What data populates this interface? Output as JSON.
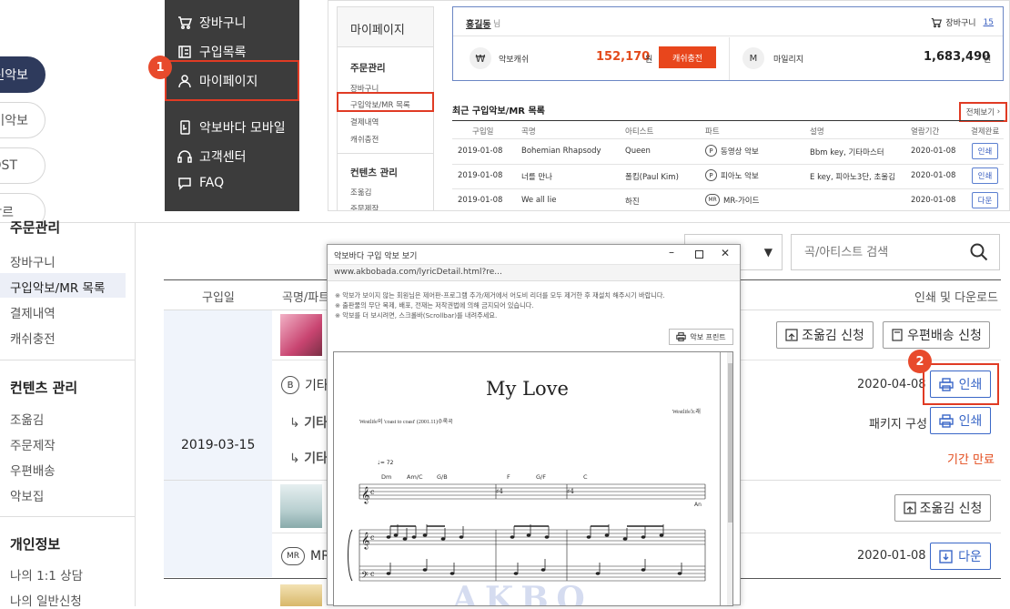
{
  "panel1": {
    "pills": [
      "신악보",
      "기악보",
      "OST",
      "장르"
    ],
    "menu": [
      "장바구니",
      "구입목록",
      "마이페이지",
      "악보바다 모바일",
      "고객센터",
      "FAQ"
    ],
    "badge": "1"
  },
  "panel2": {
    "side_title": "마이페이지",
    "order_head": "주문관리",
    "order_items": [
      "장바구니",
      "구입악보/MR 목록",
      "결제내역",
      "캐쉬충전"
    ],
    "content_head": "컨텐츠 관리",
    "content_items": [
      "조옮김",
      "주문제작"
    ],
    "user_name": "홍길동",
    "user_suffix": "님",
    "cart_label": "장바구니",
    "cart_count": "15",
    "cash_label": "악보캐쉬",
    "cash_value": "152,170",
    "won": "원",
    "charge_btn": "캐쉬충전",
    "mileage_label": "마일리지",
    "mileage_value": "1,683,490",
    "recent_title": "최근 구입악보/MR 목록",
    "view_all": "전체보기",
    "headers": [
      "구입일",
      "곡명",
      "아티스트",
      "파트",
      "설명",
      "열람기간",
      "결제완료"
    ],
    "rows": [
      {
        "date": "2019-01-08",
        "title": "Bohemian Rhapsody",
        "artist": "Queen",
        "part_icon": "P",
        "part": "동영상 악보",
        "desc": "Bbm key, 기타마스터",
        "period": "2020-01-08",
        "btn": "인쇄"
      },
      {
        "date": "2019-01-08",
        "title": "너를 만나",
        "artist": "폴킴(Paul Kim)",
        "part_icon": "P",
        "part": "피아노 악보",
        "desc": "E key, 피아노3단, 초울김",
        "period": "2020-01-08",
        "btn": "인쇄"
      },
      {
        "date": "2019-01-08",
        "title": "We all lie",
        "artist": "하진",
        "part_icon": "MR",
        "part": "MR-가이드",
        "desc": "",
        "period": "2020-01-08",
        "btn": "다운"
      }
    ]
  },
  "panel3": {
    "side_head_order": "주문관리",
    "side_order": [
      "장바구니",
      "구입악보/MR 목록",
      "결제내역",
      "캐쉬충전"
    ],
    "side_head_content": "컨텐츠 관리",
    "side_content": [
      "조옮김",
      "주문제작",
      "우편배송",
      "악보집"
    ],
    "side_head_personal": "개인정보",
    "side_personal": [
      "나의 1:1 상담",
      "나의 일반신청"
    ],
    "search_placeholder": "곡/아티스트 검색",
    "col_date": "구입일",
    "col_title": "곡명/파트",
    "col_actions": "인쇄 및 다운로드",
    "purchase_date": "2019-03-15",
    "transpose_btn": "조옮김 신청",
    "mail_btn": "우편배송 신청",
    "row_b_icon": "B",
    "row_b_text": "기타",
    "sub1": "기타",
    "sub2": "기타",
    "row1_period": "2020-04-08",
    "print_btn": "인쇄",
    "package_label": "패키지 구성",
    "expired": "기간 만료",
    "transpose_btn2": "조옮김 신청",
    "mr_icon": "MR",
    "mr_text": "MR",
    "mr_period": "2020-01-08",
    "down_btn": "다운",
    "badge": "2"
  },
  "popup": {
    "title": "악보바다 구입 악보 보기",
    "url": "www.akbobada.com/lyricDetail.html?re...",
    "notes": [
      "※ 악보가 보이지 않는 회원님은 제어판-프로그램 추가/제거에서 어도비 리더를 모두 제거한 후 재설치 해주시기 바랍니다.",
      "※ 출판물의 무단 복제, 배포, 전재는 저작권법에 의해 금지되어 있습니다.",
      "※ 악보를 더 보시려면, 스크롤바(Scrollbar)를 내려주세요."
    ],
    "print_btn": "악보 프린트",
    "sheet_title": "My Love",
    "sheet_sub_left": "Westlife의 'coast to coast' (2001.11)수록곡",
    "sheet_sub_right": "Westlife노래",
    "tempo": "♩= 72",
    "chords": [
      "Dm",
      "Am/C",
      "G/B",
      "F",
      "G/F",
      "C"
    ],
    "watermark": "AKBO",
    "an": "An"
  }
}
